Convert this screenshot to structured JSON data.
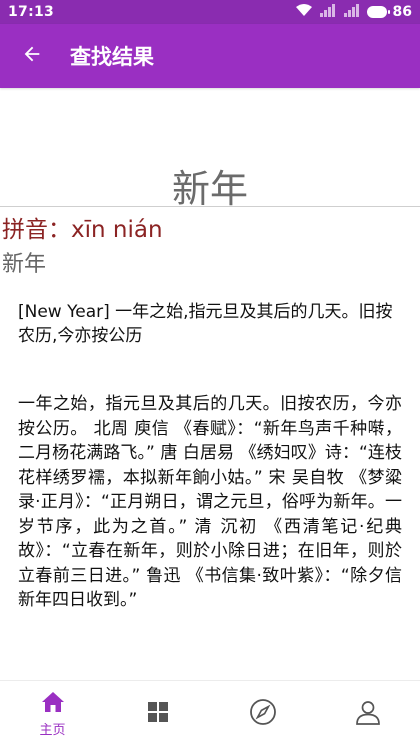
{
  "status_bar": {
    "time": "17:13",
    "battery": "86"
  },
  "app_bar": {
    "title": "查找结果"
  },
  "entry": {
    "headword": "新年",
    "pinyin_label": "拼音：xīn nián",
    "subword": "新年",
    "definition_en": "[New Year] 一年之始,指元旦及其后的几天。旧按农历,今亦按公历",
    "definition_zh": "一年之始，指元旦及其后的几天。旧按农历，今亦按公历。 北周 庾信 《春赋》：“新年鸟声千种啭，二月杨花满路飞。” 唐 白居易 《绣妇叹》诗：“连枝花样绣罗襦，本拟新年餉小姑。” 宋 吴自牧 《梦粱录·正月》：“正月朔日，谓之元旦，俗呼为新年。一岁节序，此为之首。” 清 沉初 《西清笔记·纪典故》：“立春在新年，则於小除日进；在旧年，则於立春前三日进。” 鲁迅 《书信集·致叶紫》：“除夕信新年四日收到。”"
  },
  "bottom_nav": {
    "items": [
      {
        "label": "主页",
        "icon": "home-icon",
        "active": true
      },
      {
        "label": "",
        "icon": "grid-icon",
        "active": false
      },
      {
        "label": "",
        "icon": "compass-icon",
        "active": false
      },
      {
        "label": "",
        "icon": "user-icon",
        "active": false
      }
    ]
  },
  "colors": {
    "app_bar": "#9a2fc2",
    "status_bar": "#8a2cb0",
    "pinyin": "#8b2323",
    "nav_active": "#9a2fc2",
    "nav_inactive": "#555555"
  }
}
